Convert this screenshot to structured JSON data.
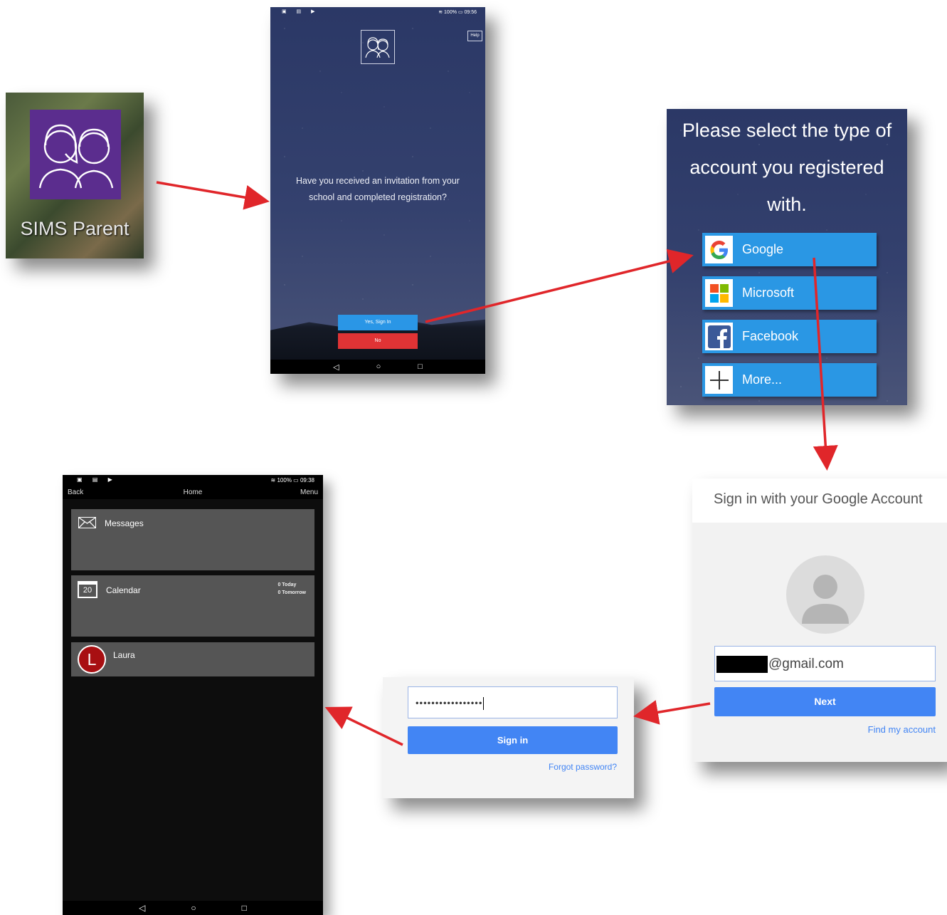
{
  "app_icon": {
    "label": "SIMS Parent"
  },
  "invite_screen": {
    "status_time": "09:56",
    "status_battery": "100%",
    "help_label": "Help",
    "question": "Have you received an invitation from your school and completed registration?",
    "yes_label": "Yes, Sign In",
    "no_label": "No"
  },
  "account_select": {
    "heading": "Please select the type of account you registered with.",
    "options": [
      {
        "label": "Google",
        "icon": "google-icon"
      },
      {
        "label": "Microsoft",
        "icon": "microsoft-icon"
      },
      {
        "label": "Facebook",
        "icon": "facebook-icon"
      },
      {
        "label": "More...",
        "icon": "plus-icon"
      }
    ]
  },
  "google_signin": {
    "title": "Sign in with your Google Account",
    "email_value": "@gmail.com",
    "next_label": "Next",
    "find_account_label": "Find my account"
  },
  "password_screen": {
    "password_value": "•••••••••••••••••",
    "signin_label": "Sign in",
    "forgot_label": "Forgot password?"
  },
  "home_screen": {
    "status_time": "09:38",
    "status_battery": "100%",
    "back_label": "Back",
    "title": "Home",
    "menu_label": "Menu",
    "messages_label": "Messages",
    "calendar_label": "Calendar",
    "calendar_day": "20",
    "today_count": "0 Today",
    "tomorrow_count": "0 Tomorrow",
    "child_initial": "L",
    "child_name": "Laura"
  },
  "colors": {
    "arrow": "#e0262a",
    "sims_purple": "#5b2d8e",
    "button_blue": "#2a97e4",
    "google_blue": "#4285f4",
    "no_red": "#e03335",
    "tile_gray": "#555555"
  }
}
